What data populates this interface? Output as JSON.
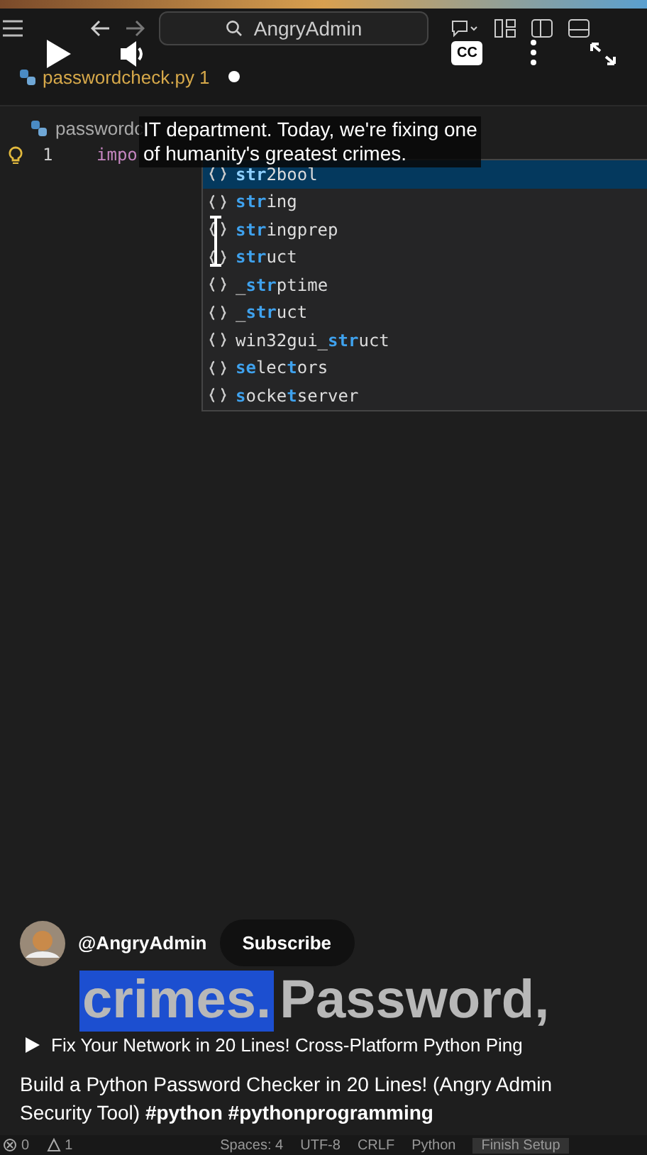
{
  "editor": {
    "search": "AngryAdmin",
    "tab": {
      "label": "passwordcheck.py 1",
      "modified": true
    },
    "breadcrumb": "passwordc",
    "lines": [
      {
        "number": "1",
        "code": "impo"
      }
    ],
    "suggestions": [
      {
        "parts": [
          {
            "text": "str",
            "match": true
          },
          {
            "text": "2bool",
            "match": false
          }
        ],
        "selected": true
      },
      {
        "parts": [
          {
            "text": "str",
            "match": true
          },
          {
            "text": "ing",
            "match": false
          }
        ],
        "selected": false
      },
      {
        "parts": [
          {
            "text": "str",
            "match": true
          },
          {
            "text": "ingprep",
            "match": false
          }
        ],
        "selected": false
      },
      {
        "parts": [
          {
            "text": "str",
            "match": true
          },
          {
            "text": "uct",
            "match": false
          }
        ],
        "selected": false
      },
      {
        "parts": [
          {
            "text": "_",
            "match": false
          },
          {
            "text": "str",
            "match": true
          },
          {
            "text": "ptime",
            "match": false
          }
        ],
        "selected": false
      },
      {
        "parts": [
          {
            "text": "_",
            "match": false
          },
          {
            "text": "str",
            "match": true
          },
          {
            "text": "uct",
            "match": false
          }
        ],
        "selected": false
      },
      {
        "parts": [
          {
            "text": "win32gui_",
            "match": false
          },
          {
            "text": "str",
            "match": true
          },
          {
            "text": "uct",
            "match": false
          }
        ],
        "selected": false
      },
      {
        "parts": [
          {
            "text": "se",
            "match": true
          },
          {
            "text": "lec",
            "match": false
          },
          {
            "text": "t",
            "match": true
          },
          {
            "text": "ors",
            "match": false
          }
        ],
        "selected": false
      },
      {
        "parts": [
          {
            "text": "s",
            "match": true
          },
          {
            "text": "ocke",
            "match": false
          },
          {
            "text": "t",
            "match": true
          },
          {
            "text": "server",
            "match": false
          }
        ],
        "selected": false
      }
    ],
    "status_bar": [
      "0",
      "1",
      "Spaces: 4",
      "UTF-8",
      "CRLF",
      "Python",
      "Finish Setup"
    ]
  },
  "player": {
    "cc": "CC",
    "caption": [
      "IT department. Today, we're fixing one",
      "of humanity's greatest crimes."
    ],
    "burned_caption": {
      "highlighted": "crimes.",
      "rest": "Password,"
    },
    "channel": {
      "handle": "@AngryAdmin",
      "subscribe": "Subscribe"
    },
    "related": "Fix Your Network in 20 Lines! Cross-Platform Python Ping",
    "title": "Build a Python Password Checker in 20 Lines! (Angry Admin Security Tool) **#python** **#pythonprogramming**"
  }
}
